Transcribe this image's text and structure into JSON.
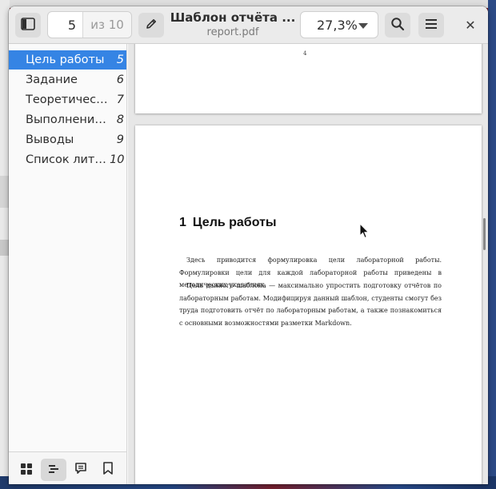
{
  "header": {
    "sidebar_toggle_icon": "sidebar-toggle-icon",
    "page_current": "5",
    "page_total": "из 10",
    "edit_icon": "pencil-icon",
    "title": "Шаблон отчёта ...",
    "subtitle": "report.pdf",
    "zoom": "27,3%",
    "search_icon": "search-icon",
    "menu_icon": "hamburger-menu-icon",
    "close_icon": "close-icon",
    "close_glyph": "✕"
  },
  "sidebar": {
    "outline": [
      {
        "label": "Цель работы",
        "page": "5",
        "selected": true
      },
      {
        "label": "Задание",
        "page": "6"
      },
      {
        "label": "Теоретичес…",
        "page": "7"
      },
      {
        "label": "Выполнение…",
        "page": "8"
      },
      {
        "label": "Выводы",
        "page": "9"
      },
      {
        "label": "Список лите…",
        "page": "10"
      }
    ],
    "tabs": [
      {
        "icon": "thumbnails-icon"
      },
      {
        "icon": "outline-icon",
        "active": true
      },
      {
        "icon": "annotations-icon"
      },
      {
        "icon": "bookmark-icon"
      }
    ]
  },
  "document": {
    "prev_page_number": "4",
    "heading_number": "1",
    "heading_text": "Цель работы",
    "paragraph1": "Здесь приводится формулировка цели лабораторной работы. Формулировки цели для каждой лабораторной работы приведены в методических указаниях.",
    "paragraph2": "Цель данного шаблона — максимально упростить подготовку отчётов по лабораторным работам. Модифицируя данный шаблон, студенты смогут без труда подготовить отчёт по лабораторным работам, а также познакомиться с основными возможностями разметки Markdown."
  },
  "colors": {
    "accent": "#3584e4",
    "headerbar": "#ebebeb"
  }
}
